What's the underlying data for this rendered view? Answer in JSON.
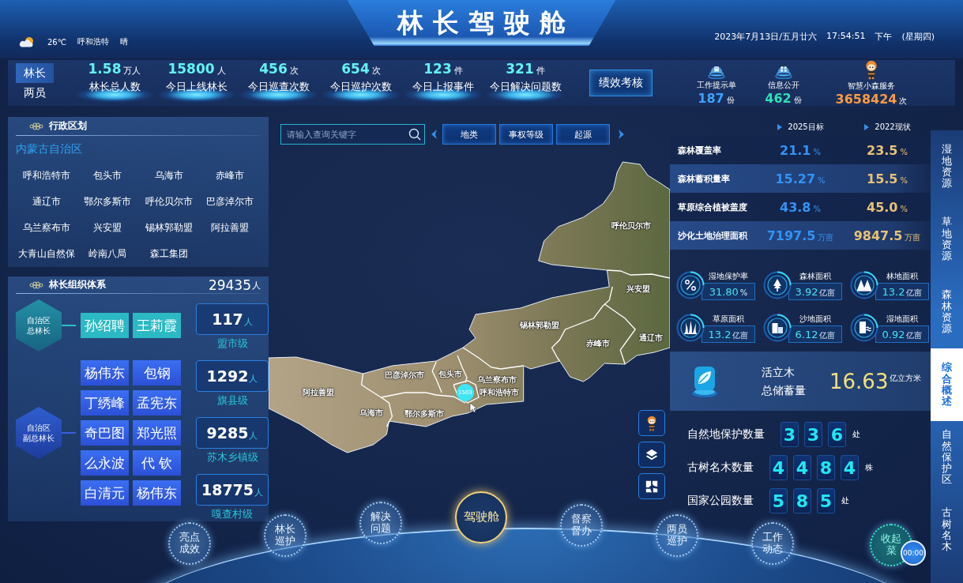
{
  "header": {
    "title": "林长驾驶舱",
    "weather": {
      "temperature": "26℃",
      "city": "呼和浩特",
      "condition": "晴"
    },
    "datetime": {
      "date": "2023年7月13日/五月廿六",
      "time": "17:54:51",
      "period": "下午",
      "weekday": "(星期四)"
    }
  },
  "stats_bar": {
    "toggle": [
      {
        "label": "林长",
        "selected": true
      },
      {
        "label": "两员",
        "selected": false
      }
    ],
    "stats": [
      {
        "value": "1.58",
        "unit": "万人",
        "label": "林长总人数"
      },
      {
        "value": "15800",
        "unit": "人",
        "label": "今日上线林长"
      },
      {
        "value": "456",
        "unit": "次",
        "label": "今日巡查次数"
      },
      {
        "value": "654",
        "unit": "次",
        "label": "今日巡护次数"
      },
      {
        "value": "123",
        "unit": "件",
        "label": "今日上报事件"
      },
      {
        "value": "321",
        "unit": "件",
        "label": "今日解决问题数"
      }
    ],
    "action_button": "绩效考核",
    "services": [
      {
        "kind": "document",
        "label": "工作提示单",
        "value": "187",
        "unit": "份"
      },
      {
        "kind": "people",
        "label": "信息公开",
        "value": "462",
        "unit": "份"
      },
      {
        "kind": "mascot",
        "label": "智慧小森服务",
        "value": "3658424",
        "unit": "次"
      }
    ]
  },
  "admin_panel": {
    "title": "行政区划",
    "region": "内蒙古自治区",
    "divisions": [
      "呼和浩特市",
      "包头市",
      "乌海市",
      "赤峰市",
      "通辽市",
      "鄂尔多斯市",
      "呼伦贝尔市",
      "巴彦淖尔市",
      "乌兰察布市",
      "兴安盟",
      "锡林郭勒盟",
      "阿拉善盟",
      "大青山自然保",
      "岭南八局",
      "森工集团"
    ]
  },
  "org_panel": {
    "title": "林长组织体系",
    "total": "29435",
    "total_unit": "人",
    "groups": [
      {
        "kind": "chief",
        "title_lines": [
          "自治区",
          "总林长"
        ],
        "names": [
          "孙绍聘",
          "王莉霞"
        ]
      },
      {
        "kind": "deputy",
        "title_lines": [
          "自治区",
          "副总林长"
        ],
        "names": [
          "杨伟东",
          "包钢",
          "丁绣峰",
          "孟宪东",
          "奇巴图",
          "郑光照",
          "么永波",
          "代 钦",
          "白清元",
          "杨伟东"
        ]
      }
    ],
    "levels": [
      {
        "value": "117",
        "unit": "人",
        "label": "盟市级"
      },
      {
        "value": "1292",
        "unit": "人",
        "label": "旗县级"
      },
      {
        "value": "9285",
        "unit": "人",
        "label": "苏木乡镇级"
      },
      {
        "value": "18775",
        "unit": "人",
        "label": "嘎查村级"
      }
    ]
  },
  "map_toolbar": {
    "search": {
      "placeholder": "请输入查询关键字"
    },
    "filters": [
      "地类",
      "事权等级",
      "起源"
    ]
  },
  "map": {
    "regions": [
      "呼伦贝尔市",
      "兴安盟",
      "锡林郭勒盟",
      "通辽市",
      "赤峰市",
      "巴彦淖尔市",
      "包头市",
      "乌兰察布市",
      "阿拉善盟",
      "呼和浩特市",
      "乌海市",
      "鄂尔多斯市"
    ],
    "marker": {
      "count": "1503"
    }
  },
  "indicators": {
    "columns": [
      "2025目标",
      "2022现状"
    ],
    "rows": [
      {
        "label": "森林覆盖率",
        "target": {
          "value": "21.1",
          "unit": "%"
        },
        "current": {
          "value": "23.5",
          "unit": "%"
        }
      },
      {
        "label": "森林蓄积量率",
        "target": {
          "value": "15.27",
          "unit": "%"
        },
        "current": {
          "value": "15.5",
          "unit": "%"
        }
      },
      {
        "label": "草原综合植被盖度",
        "target": {
          "value": "43.8",
          "unit": "%"
        },
        "current": {
          "value": "45.0",
          "unit": "%"
        }
      },
      {
        "label": "沙化土地治理面积",
        "target": {
          "value": "7197.5",
          "unit": "万亩"
        },
        "current": {
          "value": "9847.5",
          "unit": "万亩"
        }
      }
    ]
  },
  "resources": [
    {
      "kind": "percent",
      "label": "湿地保护率",
      "value": "31.80",
      "unit": "%"
    },
    {
      "kind": "tree",
      "label": "森林面积",
      "value": "3.92",
      "unit": "亿亩"
    },
    {
      "kind": "forest",
      "label": "林地面积",
      "value": "13.2",
      "unit": "亿亩"
    },
    {
      "kind": "grass",
      "label": "草原面积",
      "value": "13.2",
      "unit": "亿亩"
    },
    {
      "kind": "sand",
      "label": "沙地面积",
      "value": "6.12",
      "unit": "亿亩"
    },
    {
      "kind": "wetland",
      "label": "湿地面积",
      "value": "0.92",
      "unit": "亿亩"
    }
  ],
  "storage": {
    "label_lines": [
      "活立木",
      "总储蓄量"
    ],
    "value": "16.63",
    "unit": "亿立方米"
  },
  "counters": [
    {
      "label": "自然地保护数量",
      "digits": [
        "3",
        "3",
        "6"
      ],
      "unit": "处"
    },
    {
      "label": "古树名木数量",
      "digits": [
        "4",
        "4",
        "8",
        "4"
      ],
      "unit": "株"
    },
    {
      "label": "国家公园数量",
      "digits": [
        "5",
        "8",
        "5"
      ],
      "unit": "处"
    }
  ],
  "side_tabs": [
    {
      "label": "湿地资源",
      "selected": false
    },
    {
      "label": "草地资源",
      "selected": false
    },
    {
      "label": "森林资源",
      "selected": false
    },
    {
      "label": "综合概述",
      "selected": true
    },
    {
      "label": "自然保护区",
      "selected": false
    },
    {
      "label": "古树名木",
      "selected": false
    }
  ],
  "bottom_nav": [
    {
      "kind": "page",
      "lines": [
        "亮点",
        "成效"
      ],
      "selected": false
    },
    {
      "kind": "page",
      "lines": [
        "林长",
        "巡护"
      ],
      "selected": false
    },
    {
      "kind": "page",
      "lines": [
        "解决",
        "问题"
      ],
      "selected": false
    },
    {
      "kind": "page",
      "lines": [
        "驾驶舱"
      ],
      "selected": true
    },
    {
      "kind": "page",
      "lines": [
        "督察",
        "督办"
      ],
      "selected": false
    },
    {
      "kind": "page",
      "lines": [
        "两员",
        "巡护"
      ],
      "selected": false
    },
    {
      "kind": "page",
      "lines": [
        "工作",
        "动态"
      ],
      "selected": false
    },
    {
      "kind": "collapse",
      "lines": [
        "收起",
        "菜"
      ],
      "selected": false
    }
  ],
  "timer": "00:00"
}
